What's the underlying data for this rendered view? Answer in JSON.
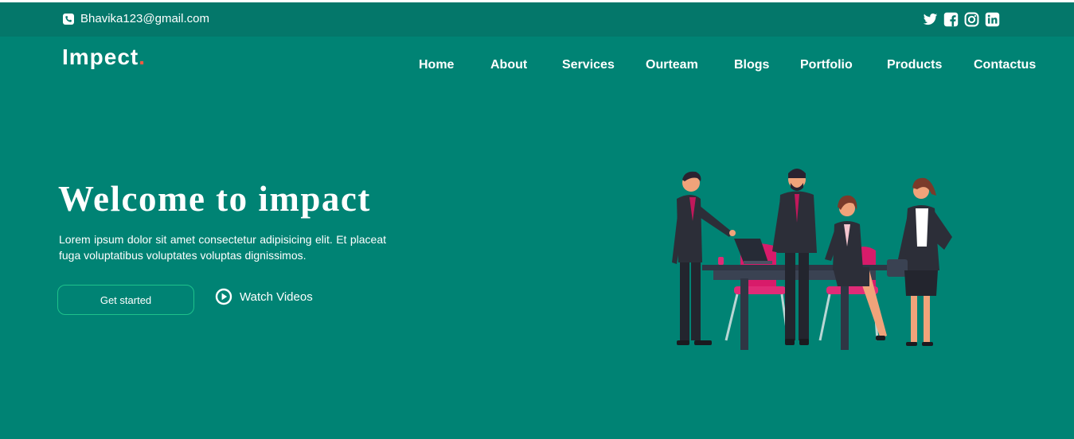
{
  "topbar": {
    "email": "Bhavika123@gmail.com",
    "contact_icon": "phone-icon",
    "socials": [
      {
        "icon": "twitter-icon"
      },
      {
        "icon": "facebook-icon"
      },
      {
        "icon": "instagram-icon"
      },
      {
        "icon": "linkedin-icon"
      }
    ]
  },
  "brand": {
    "name": "Impect",
    "dot": "."
  },
  "nav": {
    "items": [
      {
        "label": "Home"
      },
      {
        "label": "About"
      },
      {
        "label": "Services"
      },
      {
        "label": "Ourteam"
      },
      {
        "label": "Blogs"
      },
      {
        "label": "Portfolio"
      },
      {
        "label": "Products"
      },
      {
        "label": "Contactus"
      }
    ]
  },
  "hero": {
    "title": "Welcome to impact",
    "text": "Lorem ipsum dolor sit amet consectetur adipisicing elit. Et placeat fuga voluptatibus voluptates voluptas dignissimos.",
    "cta_label": "Get started",
    "video_label": "Watch Videos",
    "video_icon": "play-circle-icon",
    "illustration": "business-team-meeting-illustration"
  },
  "colors": {
    "background": "#008374",
    "topbar": "#04776a",
    "accent": "#f85a40",
    "button_border": "#1ec28b"
  }
}
